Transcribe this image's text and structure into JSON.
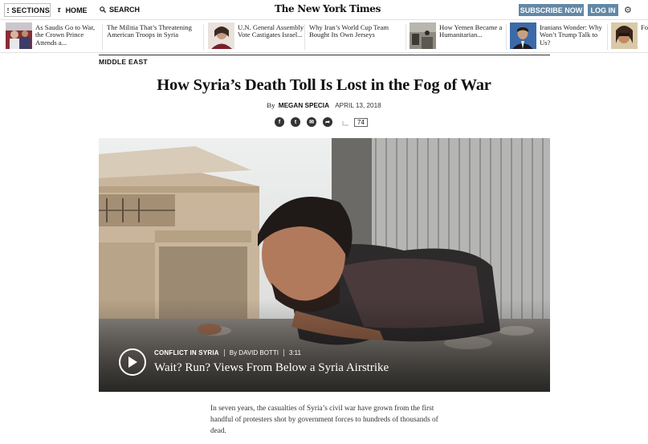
{
  "topbar": {
    "sections_label": "SECTIONS",
    "home_label": "HOME",
    "search_label": "SEARCH",
    "masthead": "The New York Times",
    "subscribe_label": "SUBSCRIBE NOW",
    "login_label": "LOG IN",
    "settings_icon": "gear-icon"
  },
  "ribbon": {
    "items": [
      {
        "title": "As Saudis Go to War, the Crown Prince Attends a...",
        "has_thumb": true
      },
      {
        "title": "The Militia That’s Threatening American Troops in Syria",
        "has_thumb": false
      },
      {
        "title": "U.N. General Assembly Vote Castigates Israel...",
        "has_thumb": true
      },
      {
        "title": "Why Iran’s World Cup Team Bought Its Own Jerseys",
        "has_thumb": false
      },
      {
        "title": "How Yemen Became a Humanitarian...",
        "has_thumb": true
      },
      {
        "title": "Iranians Wonder: Why Won’t Trump Talk to Us?",
        "has_thumb": true
      },
      {
        "title": "Fo...",
        "has_thumb": true
      }
    ]
  },
  "article": {
    "kicker": "MIDDLE EAST",
    "headline": "How Syria’s Death Toll Is Lost in the Fog of War",
    "by": "By",
    "author": "MEGAN SPECIA",
    "date": "APRIL 13, 2018",
    "share": {
      "icons": [
        "facebook-icon",
        "twitter-icon",
        "email-icon",
        "share-icon",
        "bookmark-icon"
      ],
      "comment_count": "74"
    },
    "video": {
      "series": "CONFLICT IN SYRIA",
      "byline": "By DAVID BOTTI",
      "duration": "3:11",
      "title": "Wait? Run? Views From Below a Syria Airstrike"
    },
    "body": "In seven years, the casualties of Syria’s civil war have grown from the first handful of protesters shot by government forces to hundreds of thousands of dead."
  },
  "colors": {
    "subscribe_bg": "#6288a5",
    "text": "#111111"
  }
}
